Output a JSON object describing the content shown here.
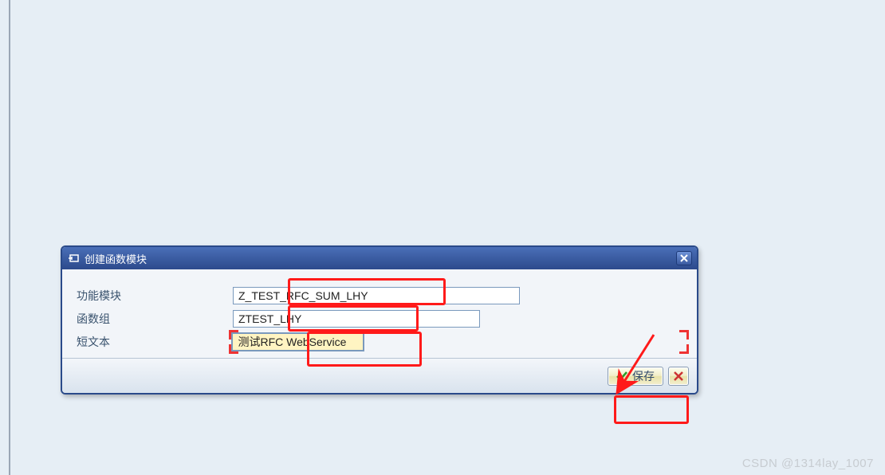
{
  "dialog": {
    "title": "创建函数模块",
    "fields": {
      "fm_label": "功能模块",
      "fm_value": "Z_TEST_RFC_SUM_LHY",
      "fg_label": "函数组",
      "fg_value": "ZTEST_LHY",
      "st_label": "短文本",
      "st_value": "测试RFC WebService"
    },
    "buttons": {
      "save": "保存"
    }
  },
  "watermark": "CSDN @1314lay_1007",
  "annotation": {
    "highlight_color": "#ff1a1a"
  }
}
